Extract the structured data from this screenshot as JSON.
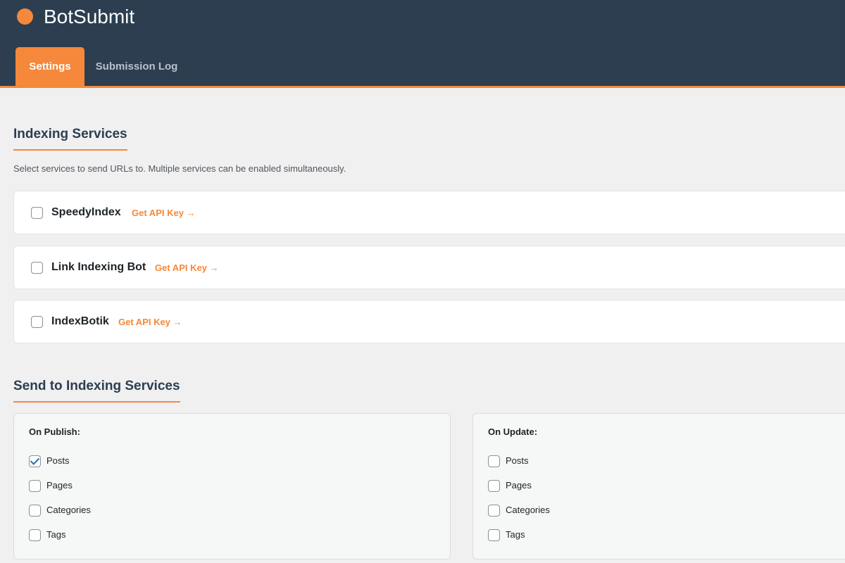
{
  "app": {
    "title": "BotSubmit",
    "accent_color": "#f5883a",
    "header_color": "#2c3e50"
  },
  "tabs": [
    {
      "label": "Settings",
      "active": true
    },
    {
      "label": "Submission Log",
      "active": false
    }
  ],
  "indexing": {
    "title": "Indexing Services",
    "description": "Select services to send URLs to. Multiple services can be enabled simultaneously.",
    "services": [
      {
        "name": "SpeedyIndex",
        "link": "Get API Key →",
        "enabled": false
      },
      {
        "name": "Link Indexing Bot",
        "link": "Get API Key →",
        "enabled": false
      },
      {
        "name": "IndexBotik",
        "link": "Get API Key →",
        "enabled": false
      }
    ]
  },
  "send": {
    "title": "Send to Indexing Services",
    "on_publish": {
      "title": "On Publish:",
      "options": [
        {
          "label": "Posts",
          "checked": true
        },
        {
          "label": "Pages",
          "checked": false
        },
        {
          "label": "Categories",
          "checked": false
        },
        {
          "label": "Tags",
          "checked": false
        }
      ]
    },
    "on_update": {
      "title": "On Update:",
      "options": [
        {
          "label": "Posts",
          "checked": false
        },
        {
          "label": "Pages",
          "checked": false
        },
        {
          "label": "Categories",
          "checked": false
        },
        {
          "label": "Tags",
          "checked": false
        }
      ]
    }
  }
}
